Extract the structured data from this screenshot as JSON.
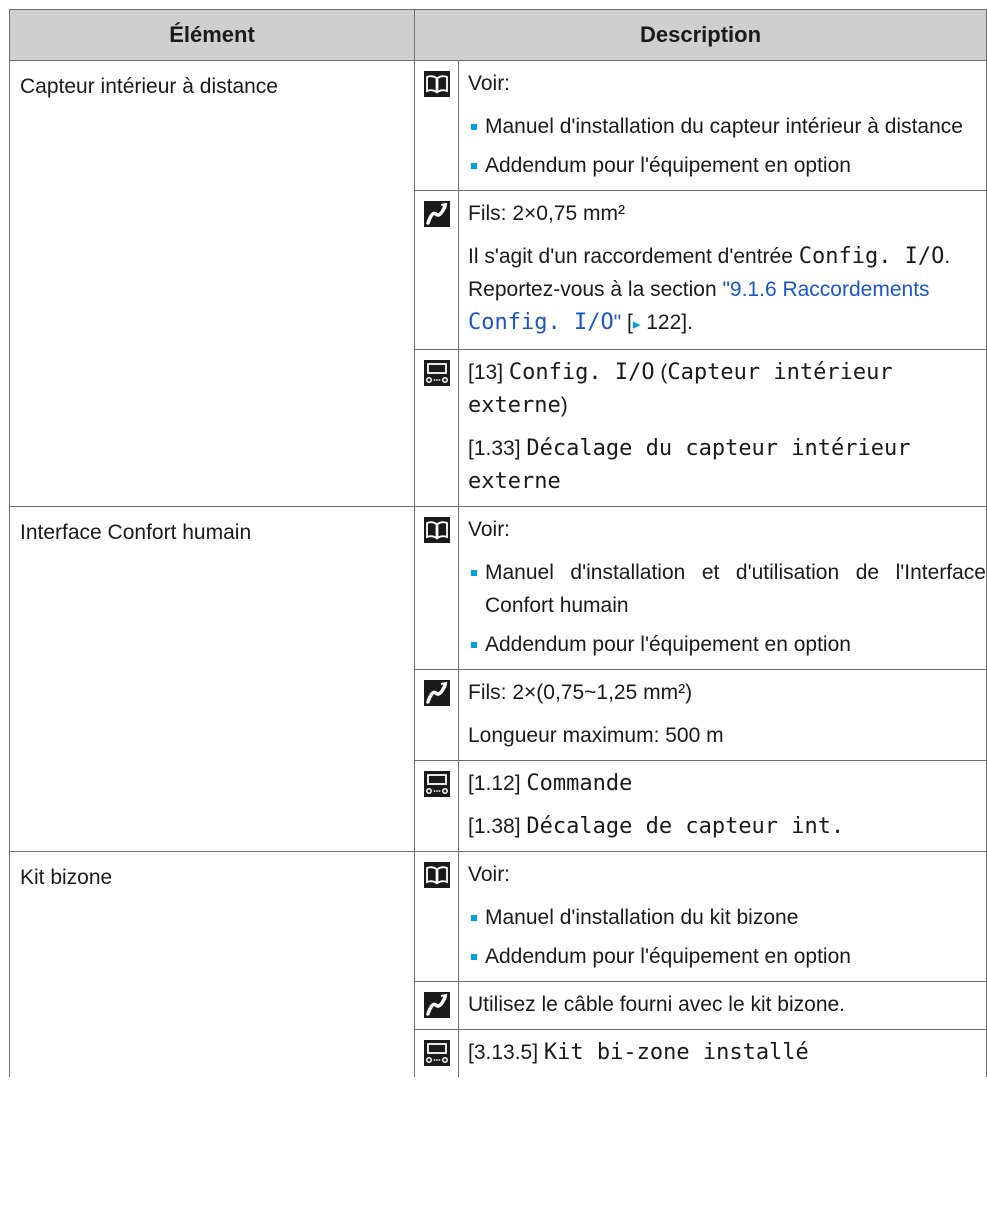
{
  "headers": {
    "element": "Élément",
    "description": "Description"
  },
  "common": {
    "voir": "Voir:",
    "addendum": "Addendum pour l'équipement en option"
  },
  "row1": {
    "element": "Capteur intérieur à distance",
    "doc_item1": "Manuel d'installation du capteur intérieur à distance",
    "wire": "Fils: 2×0,75 mm²",
    "cfg_pre": "Il s'agit d'un raccordement d'entrée ",
    "cfg_code": "Config. I/O",
    "cfg_mid": ". Reportez-vous à la section ",
    "link_text": "\"9.1.6 Raccordements ",
    "link_code": "Config. I/O",
    "link_end": "\"",
    "ref_open": " [",
    "ref_arrow": "▸",
    "ref_page": " 122].",
    "ui1_num": "[13] ",
    "ui1_code": "Config. I/O",
    "ui1_open": " (",
    "ui1_code2": "Capteur intérieur externe",
    "ui1_close": ")",
    "ui2_num": "[1.33] ",
    "ui2_code": "Décalage du capteur intérieur externe"
  },
  "row2": {
    "element": "Interface Confort humain",
    "doc_item1": "Manuel d'installation et d'utilisation de l'Interface Confort humain",
    "wire1": "Fils: 2×(0,75~1,25 mm²)",
    "wire2": "Longueur maximum: 500 m",
    "ui1_num": "[1.12] ",
    "ui1_code": "Commande",
    "ui2_num": "[1.38] ",
    "ui2_code": "Décalage de capteur int."
  },
  "row3": {
    "element": "Kit bizone",
    "doc_item1": "Manuel d'installation du kit bizone",
    "wire": "Utilisez le câble fourni avec le kit bizone.",
    "ui1_num": "[3.13.5] ",
    "ui1_code": "Kit bi-zone installé"
  }
}
